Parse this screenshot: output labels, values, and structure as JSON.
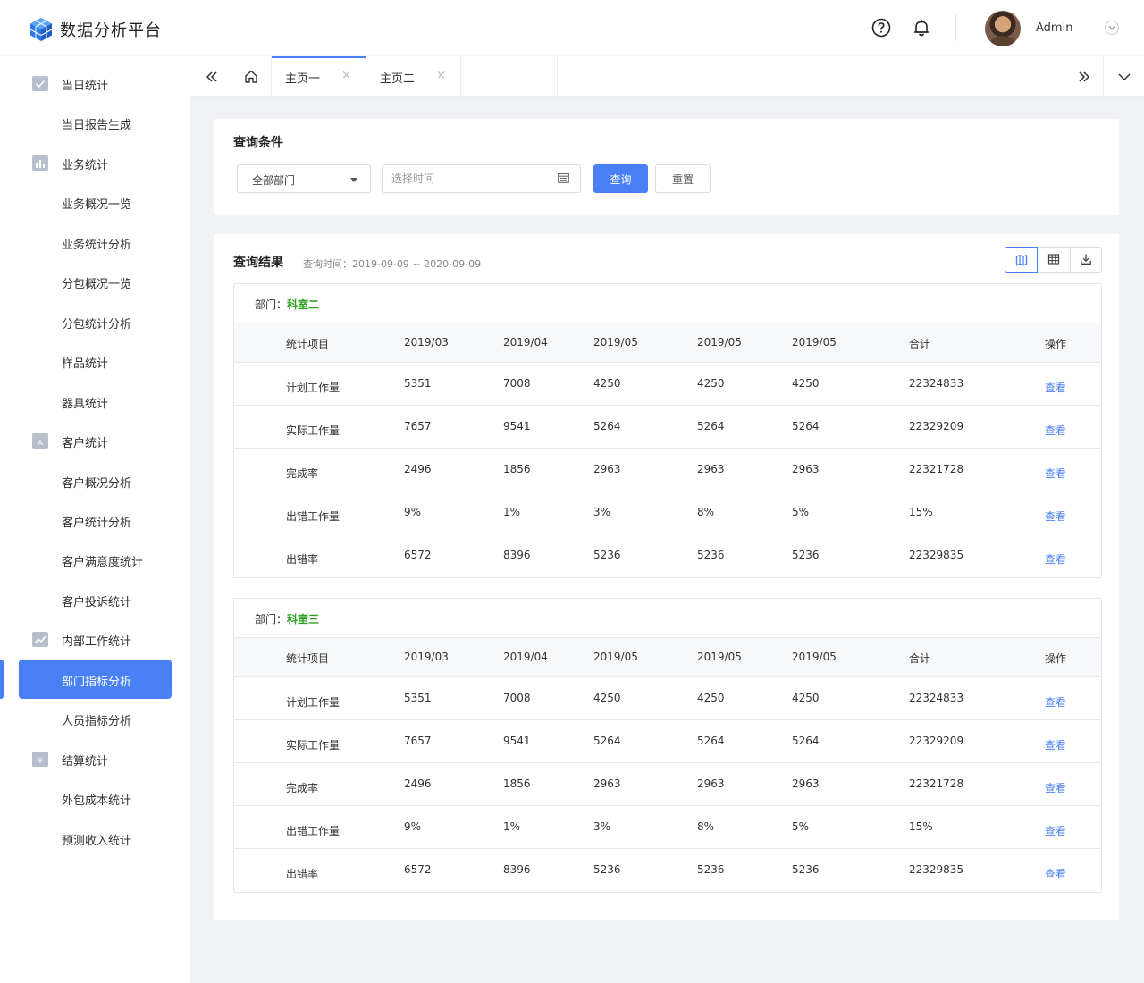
{
  "app": {
    "title": "数据分析平台"
  },
  "user": {
    "name": "Admin"
  },
  "sidebar": {
    "items": [
      {
        "label": "当日统计",
        "type": "parent",
        "icon": "checkbox-icon"
      },
      {
        "label": "当日报告生成",
        "type": "child"
      },
      {
        "label": "业务统计",
        "type": "parent",
        "icon": "bar-chart-icon"
      },
      {
        "label": "业务概况一览",
        "type": "child"
      },
      {
        "label": "业务统计分析",
        "type": "child"
      },
      {
        "label": "分包概况一览",
        "type": "child"
      },
      {
        "label": "分包统计分析",
        "type": "child"
      },
      {
        "label": "样品统计",
        "type": "child"
      },
      {
        "label": "器具统计",
        "type": "child"
      },
      {
        "label": "客户统计",
        "type": "parent",
        "icon": "contact-card-icon"
      },
      {
        "label": "客户概况分析",
        "type": "child"
      },
      {
        "label": "客户统计分析",
        "type": "child"
      },
      {
        "label": "客户满意度统计",
        "type": "child"
      },
      {
        "label": "客户投诉统计",
        "type": "child"
      },
      {
        "label": "内部工作统计",
        "type": "parent",
        "icon": "line-chart-icon"
      },
      {
        "label": "部门指标分析",
        "type": "child",
        "active": true
      },
      {
        "label": "人员指标分析",
        "type": "child"
      },
      {
        "label": "结算统计",
        "type": "parent",
        "icon": "yen-icon"
      },
      {
        "label": "外包成本统计",
        "type": "child"
      },
      {
        "label": "预测收入统计",
        "type": "child"
      }
    ]
  },
  "tabs": [
    {
      "label": "主页一",
      "active": true,
      "close": "×"
    },
    {
      "label": "主页二",
      "active": false,
      "close": "×"
    }
  ],
  "query": {
    "title": "查询条件",
    "department_value": "全部部门",
    "time_placeholder": "选择时间",
    "search_label": "查询",
    "reset_label": "重置"
  },
  "results": {
    "title": "查询结果",
    "time_range": "查询时间：2019-09-09 ~ 2020-09-09",
    "dept_prefix": "部门：",
    "columns": [
      "统计项目",
      "2019/03",
      "2019/04",
      "2019/05",
      "2019/05",
      "2019/05",
      "合计",
      "操作"
    ],
    "action_label": "查看",
    "departments": [
      {
        "name": "科室二",
        "rows": [
          [
            "计划工作量",
            "5351",
            "7008",
            "4250",
            "4250",
            "4250",
            "22324833"
          ],
          [
            "实际工作量",
            "7657",
            "9541",
            "5264",
            "5264",
            "5264",
            "22329209"
          ],
          [
            "完成率",
            "2496",
            "1856",
            "2963",
            "2963",
            "2963",
            "22321728"
          ],
          [
            "出错工作量",
            "9%",
            "1%",
            "3%",
            "8%",
            "5%",
            "15%"
          ],
          [
            "出错率",
            "6572",
            "8396",
            "5236",
            "5236",
            "5236",
            "22329835"
          ]
        ]
      },
      {
        "name": "科室三",
        "rows": [
          [
            "计划工作量",
            "5351",
            "7008",
            "4250",
            "4250",
            "4250",
            "22324833"
          ],
          [
            "实际工作量",
            "7657",
            "9541",
            "5264",
            "5264",
            "5264",
            "22329209"
          ],
          [
            "完成率",
            "2496",
            "1856",
            "2963",
            "2963",
            "2963",
            "22321728"
          ],
          [
            "出错工作量",
            "9%",
            "1%",
            "3%",
            "8%",
            "5%",
            "15%"
          ],
          [
            "出错率",
            "6572",
            "8396",
            "5236",
            "5236",
            "5236",
            "22329835"
          ]
        ]
      }
    ]
  },
  "colors": {
    "primary": "#4a80f5",
    "dept_name": "#2ea121",
    "sidebar_icon": "#b9bfca"
  }
}
